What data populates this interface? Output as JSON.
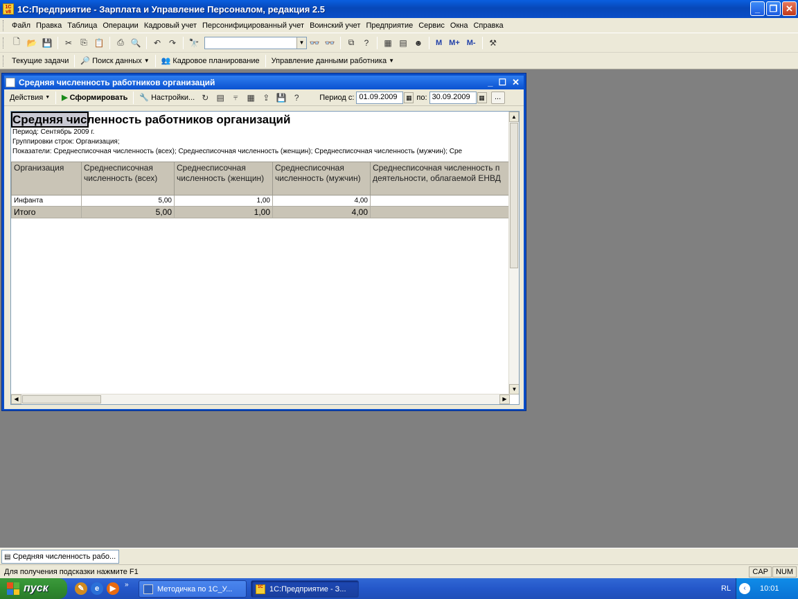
{
  "app": {
    "title": "1С:Предприятие - Зарплата и Управление Персоналом, редакция 2.5",
    "icon_label": "1C v8"
  },
  "menu": [
    "Файл",
    "Правка",
    "Таблица",
    "Операции",
    "Кадровый учет",
    "Персонифицированный учет",
    "Воинский учет",
    "Предприятие",
    "Сервис",
    "Окна",
    "Справка"
  ],
  "toolbar1": {
    "icons": [
      "new-icon",
      "open-icon",
      "save-icon",
      "cut-icon",
      "copy-icon",
      "paste-icon",
      "print-icon",
      "preview-icon",
      "undo-icon",
      "redo-icon",
      "find-icon",
      "find-next-icon",
      "find-prev-icon",
      "windows-icon",
      "help-icon",
      "calculator-icon",
      "calendar-icon",
      "user-icon",
      "memory-icon",
      "tools-icon"
    ],
    "search_value": "",
    "memory": [
      "M",
      "M+",
      "M-"
    ]
  },
  "toolbar2": {
    "items": [
      "Текущие задачи",
      "Поиск данных",
      "Кадровое планирование",
      "Управление данными работника"
    ]
  },
  "report_window": {
    "title": "Средняя численность работников организаций",
    "toolbar": {
      "actions": "Действия",
      "generate": "Сформировать",
      "settings": "Настройки...",
      "period_from_label": "Период с:",
      "period_from": "01.09.2009",
      "period_to_label": "по:",
      "period_to": "30.09.2009",
      "more": "..."
    },
    "report": {
      "title_selected": "Средняя чис",
      "title_rest": "ленность работников организаций",
      "period": "Период: Сентябрь 2009 г.",
      "grouping": "Группировки строк: Организация;",
      "indicators": "Показатели: Среднесписочная численность (всех); Среднесписочная численность (женщин); Среднесписочная численность (мужчин); Сре",
      "columns": [
        "Организация",
        "Среднесписочная численность (всех)",
        "Среднесписочная численность (женщин)",
        "Среднесписочная численность (мужчин)",
        "Среднесписочная численность п деятельности, облагаемой ЕНВД"
      ],
      "rows": [
        {
          "org": "Инфанта",
          "all": "5,00",
          "women": "1,00",
          "men": "4,00",
          "envd": ""
        }
      ],
      "total": {
        "org": "Итого",
        "all": "5,00",
        "women": "1,00",
        "men": "4,00",
        "envd": ""
      }
    }
  },
  "window_tab": "Средняя численность рабо...",
  "status": {
    "hint": "Для получения подсказки нажмите F1",
    "cap": "CAP",
    "num": "NUM"
  },
  "taskbar": {
    "start": "пуск",
    "buttons": [
      "Методичка по 1С_У...",
      "1С:Предприятие - З..."
    ],
    "lang": "RL",
    "time": "10:01"
  }
}
